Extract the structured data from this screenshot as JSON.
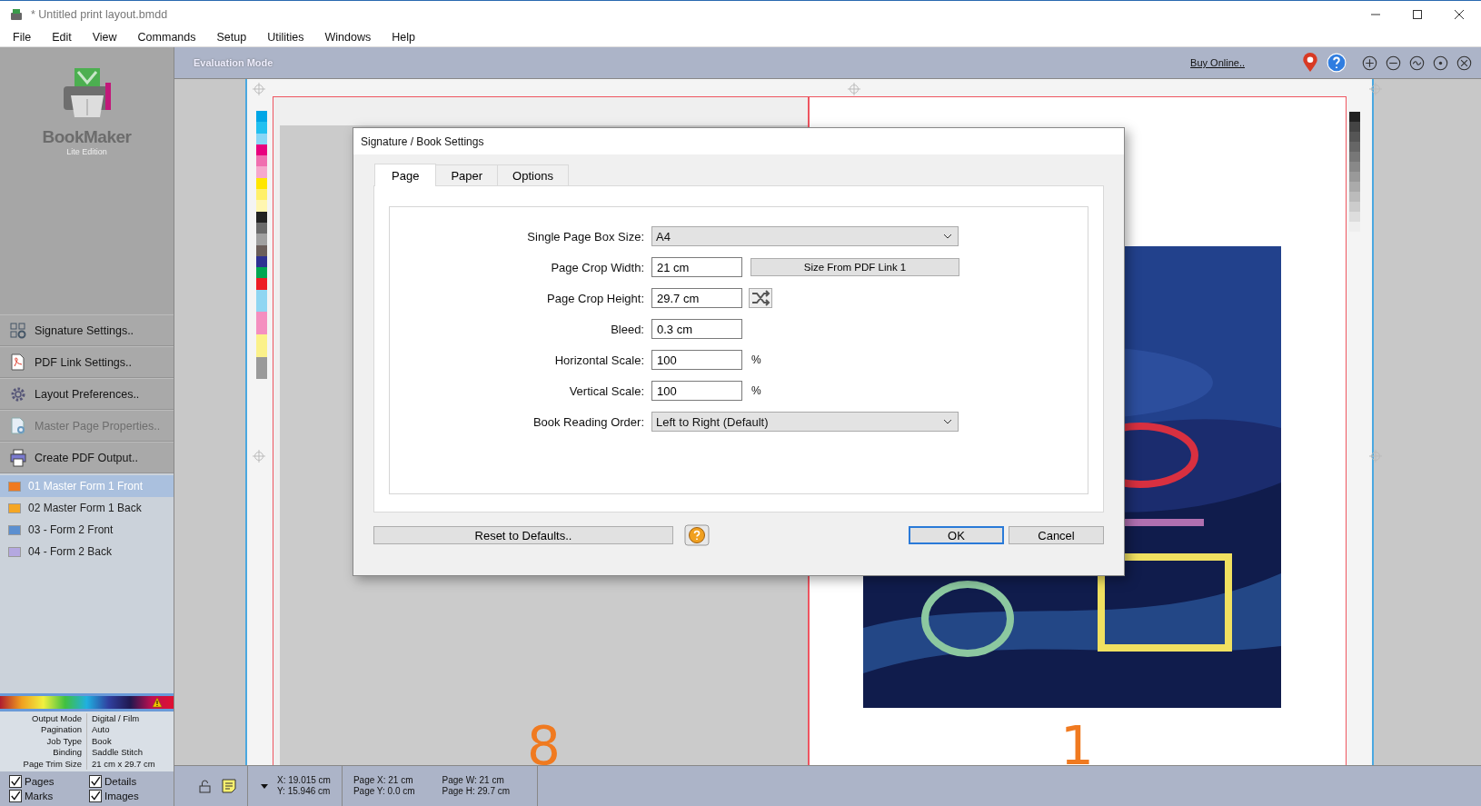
{
  "window": {
    "title": "* Untitled print layout.bmdd"
  },
  "menu": [
    "File",
    "Edit",
    "View",
    "Commands",
    "Setup",
    "Utilities",
    "Windows",
    "Help"
  ],
  "sidebar": {
    "logo": {
      "name": "BookMaker",
      "edition": "Lite Edition"
    },
    "actions": [
      {
        "label": "Signature Settings..",
        "disabled": false
      },
      {
        "label": "PDF Link Settings..",
        "disabled": false
      },
      {
        "label": "Layout Preferences..",
        "disabled": false
      },
      {
        "label": "Master Page Properties..",
        "disabled": true
      },
      {
        "label": "Create PDF Output..",
        "disabled": false
      }
    ],
    "forms": [
      {
        "label": "01 Master Form 1 Front",
        "selected": true,
        "color": "#f07a20"
      },
      {
        "label": "02 Master Form 1 Back",
        "selected": false,
        "color": "#f5a623"
      },
      {
        "label": "03 - Form 2 Front",
        "selected": false,
        "color": "#5b8fd0"
      },
      {
        "label": "04 - Form 2 Back",
        "selected": false,
        "color": "#b4a8e0"
      }
    ],
    "info": [
      {
        "label": "Output Mode",
        "value": "Digital / Film"
      },
      {
        "label": "Pagination",
        "value": "Auto"
      },
      {
        "label": "Job Type",
        "value": "Book"
      },
      {
        "label": "Binding",
        "value": "Saddle Stitch"
      },
      {
        "label": "Page Trim Size",
        "value": "21 cm x 29.7 cm"
      }
    ],
    "toggles": [
      {
        "label": "Pages",
        "checked": true
      },
      {
        "label": "Details",
        "checked": true
      },
      {
        "label": "Marks",
        "checked": true
      },
      {
        "label": "Images",
        "checked": true
      }
    ]
  },
  "toolbar": {
    "mode": "Evaluation Mode",
    "link": "Buy Online.."
  },
  "canvas": {
    "page_numbers": [
      "8",
      "1"
    ]
  },
  "dialog": {
    "title": "Signature / Book Settings",
    "tabs": [
      {
        "label": "Page",
        "selected": true
      },
      {
        "label": "Paper",
        "selected": false
      },
      {
        "label": "Options",
        "selected": false
      }
    ],
    "rows": [
      {
        "kind": "select",
        "label": "Single Page Box Size:",
        "value": "A4"
      },
      {
        "kind": "text",
        "label": "Page Crop Width:",
        "value": "21 cm",
        "button": "Size From PDF Link 1"
      },
      {
        "kind": "swap",
        "label": "Page Crop Height:",
        "value": "29.7 cm"
      },
      {
        "kind": "text",
        "label": "Bleed:",
        "value": "0.3 cm"
      },
      {
        "kind": "text",
        "label": "Horizontal Scale:",
        "value": "100",
        "unit": "%"
      },
      {
        "kind": "text",
        "label": "Vertical Scale:",
        "value": "100",
        "unit": "%"
      },
      {
        "kind": "select",
        "label": "Book Reading Order:",
        "value": "Left to Right (Default)"
      }
    ],
    "reset": "Reset to Defaults..",
    "ok": "OK",
    "cancel": "Cancel"
  },
  "status": {
    "x": "X: 19.015 cm",
    "y": "Y: 15.946 cm",
    "page_x": "Page X: 21 cm",
    "page_y": "Page Y: 0.0 cm",
    "page_w": "Page W: 21 cm",
    "page_h": "Page H: 29.7 cm"
  }
}
